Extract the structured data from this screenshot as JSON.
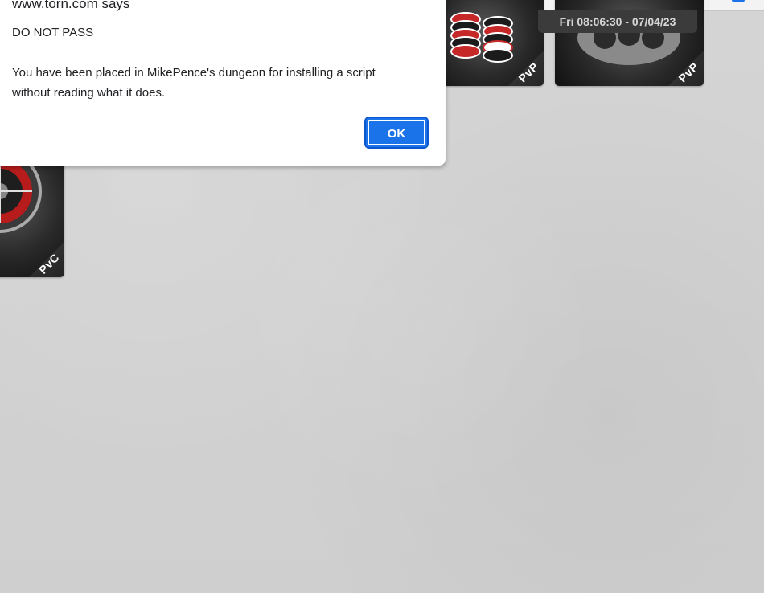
{
  "browser_bar": {
    "accent_colors": [
      "#1e8e3e",
      "#1a73e8"
    ]
  },
  "clock": {
    "text": "Fri 08:06:30 - 07/04/23"
  },
  "tiles": [
    {
      "name": "poker-tile",
      "tag": "PvP",
      "icon": "poker-chips-icon"
    },
    {
      "name": "brass-knuckles-tile",
      "tag": "PvP",
      "icon": "brass-knuckles-icon"
    },
    {
      "name": "roulette-tile",
      "tag": "PvC",
      "icon": "roulette-wheel-icon"
    }
  ],
  "dialog": {
    "title": "www.torn.com says",
    "line1": "DO NOT PASS",
    "line2": "You have been placed in MikePence's dungeon for installing a script",
    "line3": "without reading what it does.",
    "ok_label": "OK",
    "ok_color": "#1a73e8"
  }
}
